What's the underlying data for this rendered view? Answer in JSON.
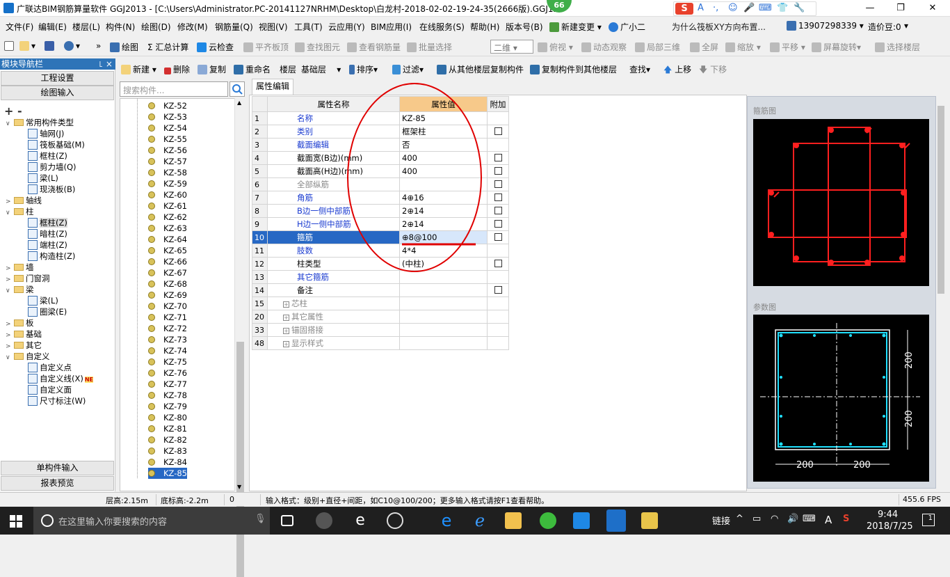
{
  "title": {
    "text": "广联达BIM钢筋算量软件 GGJ2013 - [C:\\Users\\Administrator.PC-20141127NRHM\\Desktop\\白龙村-2018-02-02-19-24-35(2666版).GGJ12",
    "badge": "66",
    "ime_glyphs": [
      "A",
      "·,",
      "☺",
      "🎤",
      "⌨",
      "👕",
      "🔧"
    ]
  },
  "menu": [
    "文件(F)",
    "编辑(E)",
    "楼层(L)",
    "构件(N)",
    "绘图(D)",
    "修改(M)",
    "钢筋量(Q)",
    "视图(V)",
    "工具(T)",
    "云应用(Y)",
    "BIM应用(I)",
    "在线服务(S)",
    "帮助(H)",
    "版本号(B)",
    "新建变更 ▾",
    "广小二"
  ],
  "menu_right": {
    "tip": "为什么筏板XY方向布置...",
    "phone": "13907298339",
    "account": "造价豆:0"
  },
  "toolbar1": {
    "items": [
      "绘图",
      "Σ 汇总计算",
      "云检查",
      "平齐板顶",
      "查找图元",
      "查看钢筋量",
      "批量选择",
      "二维",
      "俯视",
      "动态观察",
      "局部三维",
      "全屏",
      "缩放",
      "平移",
      "屏幕旋转",
      "选择楼层"
    ]
  },
  "toolbar2": {
    "items": [
      "新建",
      "删除",
      "复制",
      "重命名",
      "楼层",
      "基础层",
      "排序",
      "过滤",
      "从其他楼层复制构件",
      "复制构件到其他楼层",
      "查找",
      "上移",
      "下移"
    ]
  },
  "nav": {
    "header": "模块导航栏",
    "pin": "꜖ ×",
    "top_buttons": [
      "工程设置",
      "绘图输入"
    ],
    "bottom_buttons": [
      "单构件输入",
      "报表预览"
    ],
    "expand_icons": "+ -",
    "tree": [
      {
        "label": "常用构件类型",
        "level": 0,
        "exp": "∨",
        "folder": true
      },
      {
        "label": "轴网(J)",
        "level": 1
      },
      {
        "label": "筏板基础(M)",
        "level": 1
      },
      {
        "label": "框柱(Z)",
        "level": 1
      },
      {
        "label": "剪力墙(Q)",
        "level": 1
      },
      {
        "label": "梁(L)",
        "level": 1
      },
      {
        "label": "现浇板(B)",
        "level": 1
      },
      {
        "label": "轴线",
        "level": 0,
        "exp": ">",
        "folder": true
      },
      {
        "label": "柱",
        "level": 0,
        "exp": "∨",
        "folder": true
      },
      {
        "label": "框柱(Z)",
        "level": 1,
        "selected": true
      },
      {
        "label": "暗柱(Z)",
        "level": 1
      },
      {
        "label": "端柱(Z)",
        "level": 1
      },
      {
        "label": "构造柱(Z)",
        "level": 1
      },
      {
        "label": "墙",
        "level": 0,
        "exp": ">",
        "folder": true
      },
      {
        "label": "门窗洞",
        "level": 0,
        "exp": ">",
        "folder": true
      },
      {
        "label": "梁",
        "level": 0,
        "exp": "∨",
        "folder": true
      },
      {
        "label": "梁(L)",
        "level": 1
      },
      {
        "label": "圈梁(E)",
        "level": 1
      },
      {
        "label": "板",
        "level": 0,
        "exp": ">",
        "folder": true
      },
      {
        "label": "基础",
        "level": 0,
        "exp": ">",
        "folder": true
      },
      {
        "label": "其它",
        "level": 0,
        "exp": ">",
        "folder": true
      },
      {
        "label": "自定义",
        "level": 0,
        "exp": "∨",
        "folder": true
      },
      {
        "label": "自定义点",
        "level": 1
      },
      {
        "label": "自定义线(X)",
        "level": 1,
        "new": "NE"
      },
      {
        "label": "自定义面",
        "level": 1
      },
      {
        "label": "尺寸标注(W)",
        "level": 1
      }
    ]
  },
  "component_list": {
    "search_placeholder": "搜索构件...",
    "items": [
      "KZ-52",
      "KZ-53",
      "KZ-54",
      "KZ-55",
      "KZ-56",
      "KZ-57",
      "KZ-58",
      "KZ-59",
      "KZ-60",
      "KZ-61",
      "KZ-62",
      "KZ-63",
      "KZ-64",
      "KZ-65",
      "KZ-66",
      "KZ-67",
      "KZ-68",
      "KZ-69",
      "KZ-70",
      "KZ-71",
      "KZ-72",
      "KZ-73",
      "KZ-74",
      "KZ-75",
      "KZ-76",
      "KZ-77",
      "KZ-78",
      "KZ-79",
      "KZ-80",
      "KZ-81",
      "KZ-82",
      "KZ-83",
      "KZ-84",
      "KZ-85"
    ],
    "selected": "KZ-85"
  },
  "property_tab": "属性编辑",
  "property_grid": {
    "headers": [
      "属性名称",
      "属性值",
      "附加"
    ],
    "rows": [
      {
        "num": "1",
        "name": "名称",
        "value": "KZ-85",
        "checkbox": false
      },
      {
        "num": "2",
        "name": "类别",
        "value": "框架柱",
        "checkbox": true
      },
      {
        "num": "3",
        "name": "截面编辑",
        "value": "否",
        "checkbox": false
      },
      {
        "num": "4",
        "name": "截面宽(B边)(mm)",
        "value": "400",
        "checkbox": true,
        "black": true
      },
      {
        "num": "5",
        "name": "截面高(H边)(mm)",
        "value": "400",
        "checkbox": true,
        "black": true
      },
      {
        "num": "6",
        "name": "全部纵筋",
        "value": "",
        "checkbox": true,
        "gray": true
      },
      {
        "num": "7",
        "name": "角筋",
        "value": "4⊕16",
        "checkbox": true
      },
      {
        "num": "8",
        "name": "B边一侧中部筋",
        "value": "2⊕14",
        "checkbox": true
      },
      {
        "num": "9",
        "name": "H边一侧中部筋",
        "value": "2⊕14",
        "checkbox": true
      },
      {
        "num": "10",
        "name": "箍筋",
        "value": "⊕8@100",
        "checkbox": true,
        "highlight": true
      },
      {
        "num": "11",
        "name": "肢数",
        "value": "4*4",
        "checkbox": false
      },
      {
        "num": "12",
        "name": "柱类型",
        "value": "(中柱)",
        "checkbox": true,
        "black": true
      },
      {
        "num": "13",
        "name": "其它箍筋",
        "value": "",
        "checkbox": false
      },
      {
        "num": "14",
        "name": "备注",
        "value": "",
        "checkbox": true,
        "black": true
      },
      {
        "num": "15",
        "name": "芯柱",
        "value": "",
        "checkbox": false,
        "group": true
      },
      {
        "num": "20",
        "name": "其它属性",
        "value": "",
        "checkbox": false,
        "group": true
      },
      {
        "num": "33",
        "name": "锚固搭接",
        "value": "",
        "checkbox": false,
        "group": true
      },
      {
        "num": "48",
        "name": "显示样式",
        "value": "",
        "checkbox": false,
        "group": true
      }
    ]
  },
  "stirrup_panel": {
    "label": "箍筋图"
  },
  "param_panel": {
    "label": "参数图",
    "dim_top": "200",
    "dim_bottom": "200",
    "dim_left": "200",
    "dim_right": "200"
  },
  "status": {
    "floor_height": "层高:2.15m",
    "bottom_elev": "底标高:-2.2m",
    "zero": "0",
    "hint": "输入格式：级别+直径+间距，如C10@100/200；更多输入格式请按F1查看帮助。",
    "fps": "455.6 FPS"
  },
  "taskbar": {
    "search_placeholder": "在这里输入你要搜索的内容",
    "link": "链接",
    "time": "9:44",
    "date": "2018/7/25",
    "lang": "A",
    "notif": "1"
  },
  "colors": {
    "accent": "#2768c4",
    "header_orange": "#f7c98a",
    "rebar_red": "#ff1f1f",
    "cyan": "#20e0ff",
    "annotation_red": "#e00000"
  }
}
